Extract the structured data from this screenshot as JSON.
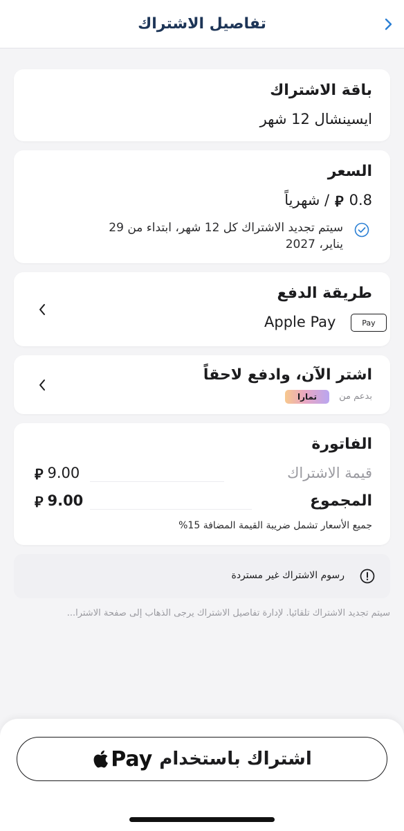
{
  "header": {
    "title": "تفاصيل الاشتراك",
    "back_icon": "chevron-right-icon",
    "accent": "#1d3557",
    "back_color": "#2a7fd4"
  },
  "plan": {
    "title": "باقة الاشتراك",
    "value": "ايسينشال 12 شهر"
  },
  "price": {
    "title": "السعر",
    "amount": "0.8",
    "currency_symbol": "⃁",
    "per": "/ شهرياً",
    "renewal_note_line1": "سيتم تجديد الاشتراك كل 12 شهر، ابتداء من 29",
    "renewal_note_line2": "يناير، 2027",
    "check_icon": "check-circle-icon"
  },
  "payment_method": {
    "title": "طريقة الدفع",
    "value": "Apple Pay",
    "badge": " Pay",
    "chevron_icon": "chevron-left-icon"
  },
  "bnpl": {
    "title": "اشتر الآن، وادفع لاحقاً",
    "powered_by": "بدعم من",
    "provider": "تمارا",
    "chevron_icon": "chevron-left-icon"
  },
  "invoice": {
    "title": "الفاتورة",
    "subscription_label": "قيمة الاشتراك",
    "subscription_value": "9.00",
    "total_label": "المجموع",
    "total_value": "9.00",
    "vat_note": "جميع الأسعار تشمل ضريبة القيمة المضافة 15%"
  },
  "notice": {
    "text": "رسوم الاشتراك غير مستردة",
    "icon": "info-circle-icon"
  },
  "footer_note": "سيتم تجديد الاشتراك تلقائياً. لإدارة تفاصيل الاشتراك يرجى الذهاب إلى صفحة الاشترا...",
  "cta": {
    "label": "اشتراك باستخدام",
    "pay_text": "Pay",
    "icon": "apple-logo-icon"
  }
}
